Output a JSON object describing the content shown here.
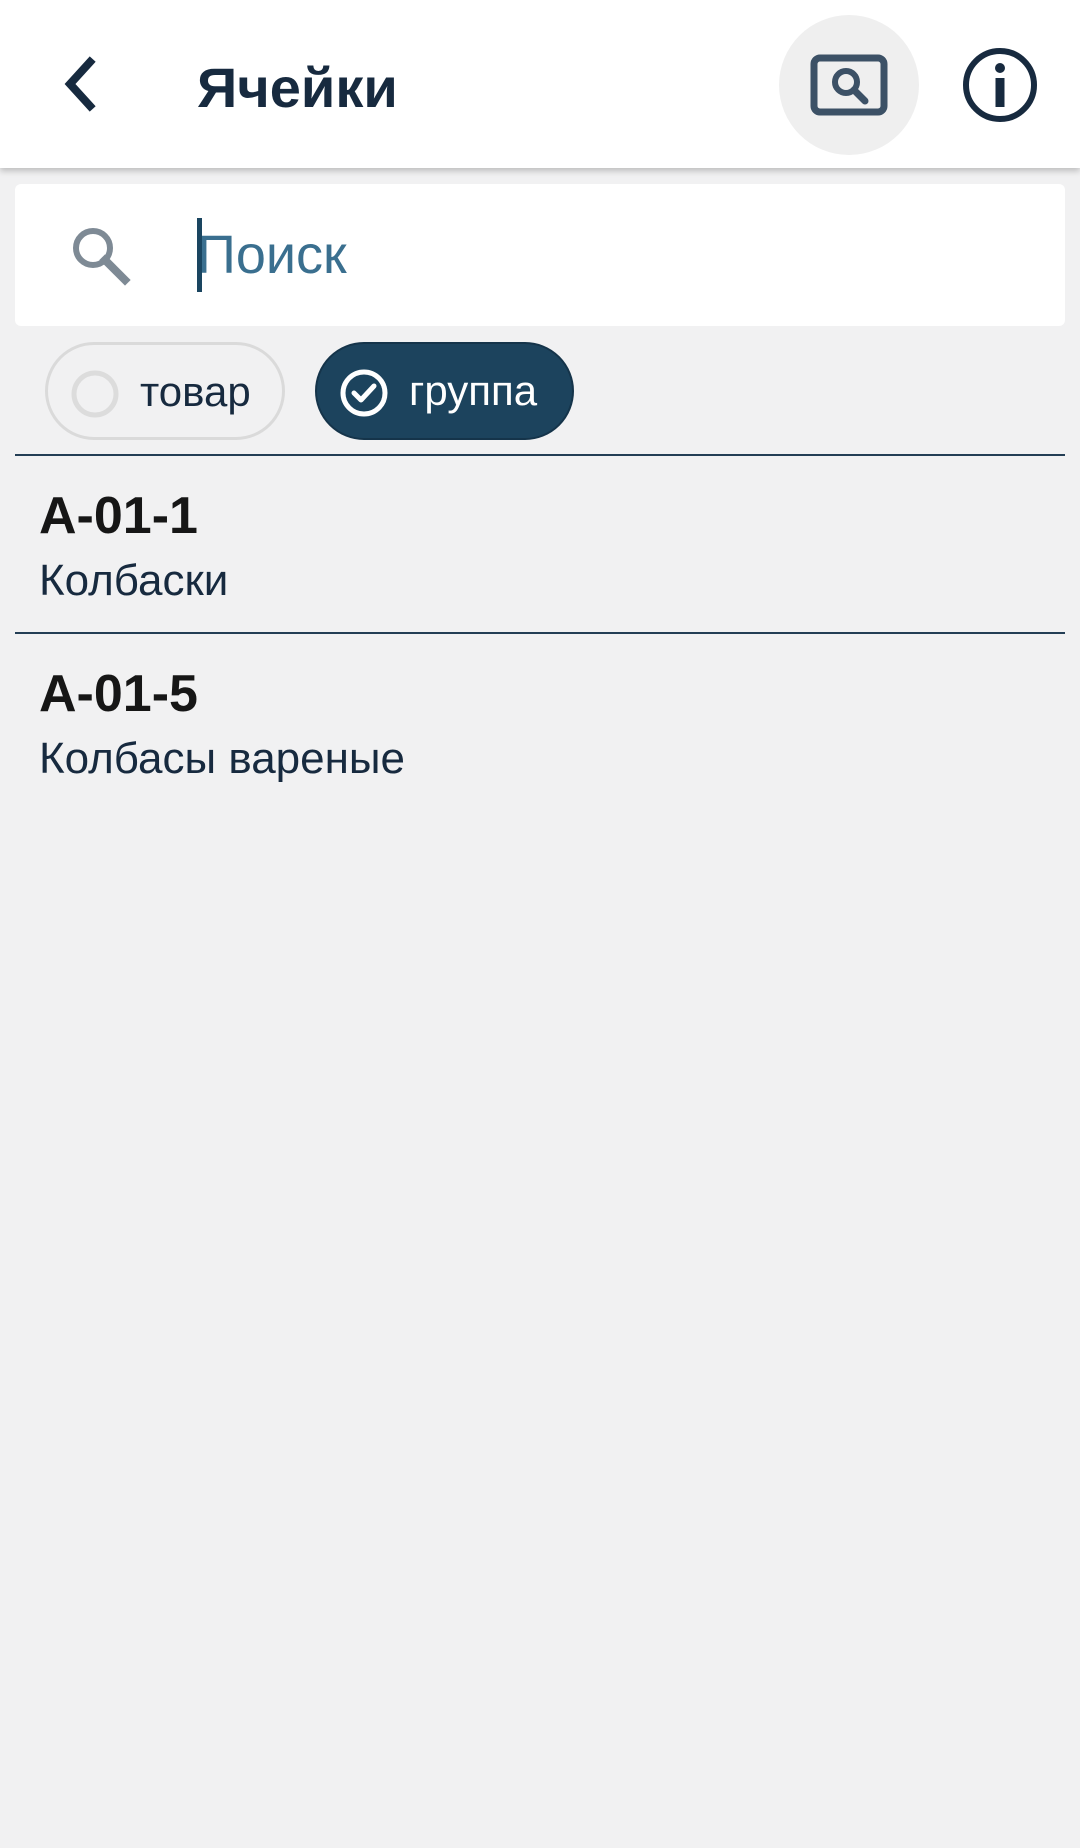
{
  "header": {
    "title": "Ячейки",
    "back_icon": "chevron-left-icon",
    "scan_icon": "scan-search-icon",
    "info_icon": "info-icon"
  },
  "search": {
    "placeholder": "Поиск",
    "value": ""
  },
  "filters": [
    {
      "label": "товар",
      "selected": false
    },
    {
      "label": "группа",
      "selected": true
    }
  ],
  "cells": [
    {
      "code": "A-01-1",
      "name": "Колбаски"
    },
    {
      "code": "A-01-5",
      "name": "Колбасы вареные"
    }
  ],
  "colors": {
    "primary": "#1c435d",
    "text": "#172a3f",
    "background": "#f1f1f2"
  }
}
